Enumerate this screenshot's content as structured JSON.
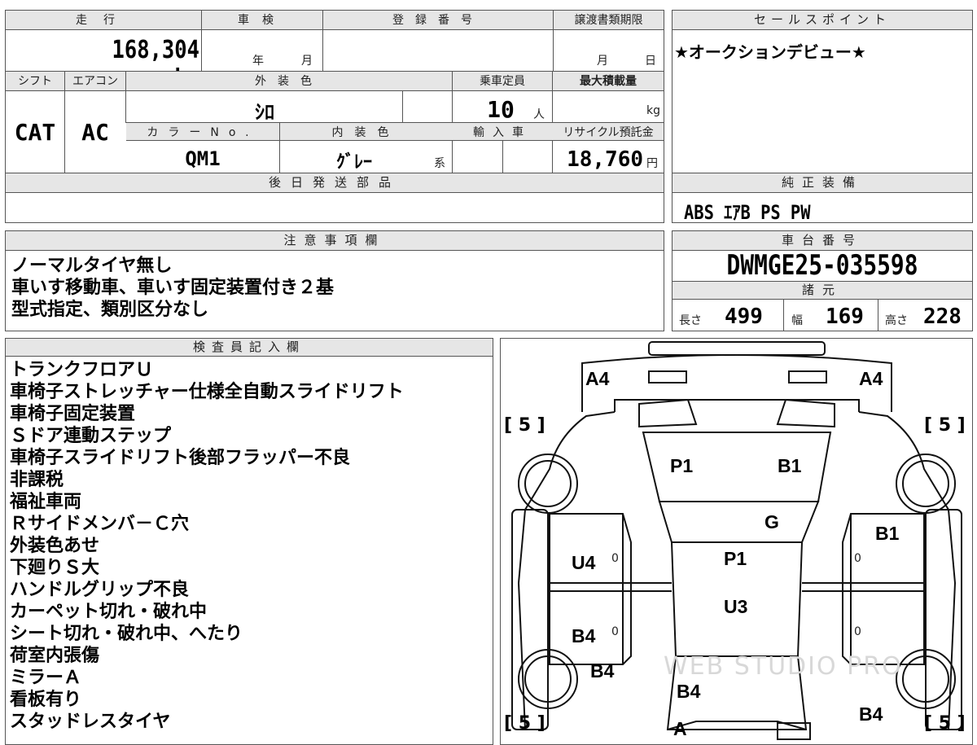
{
  "header": {
    "mileage_label": "走行",
    "shaken_label": "車検",
    "reg_label": "登録番号",
    "deadline_label": "譲渡書類期限",
    "sales_label": "セールスポイント",
    "mileage": "168,304 km",
    "shaken_year": "年",
    "shaken_month": "月",
    "deadline_month": "月",
    "deadline_day": "日"
  },
  "row2": {
    "shift_label": "シフト",
    "ac_label": "エアコン",
    "ext_color_label": "外装色",
    "capacity_label": "乗車定員",
    "max_load_label": "最大積載量",
    "shift": "CAT",
    "ac": "AC",
    "ext_color": "ｼﾛ",
    "capacity": "10",
    "capacity_unit": "人",
    "load_unit": "kg",
    "color_no_label": "カラーNo.",
    "int_color_label": "内装色",
    "import_label": "輸入車",
    "recycle_label": "リサイクル預託金",
    "color_no": "QM1",
    "int_color": "ｸﾞﾚｰ",
    "int_color_suffix": "系",
    "recycle": "18,760",
    "recycle_unit": "円"
  },
  "later_parts_label": "後日発送部品",
  "sales_point": "★オークションデビュー★",
  "equipment": {
    "label": "純正装備",
    "value": "ABS ｴｱB PS PW"
  },
  "notes": {
    "label": "注意事項欄",
    "lines": [
      "ノーマルタイヤ無し",
      "車いす移動車、車いす固定装置付き２基",
      "型式指定、類別区分なし"
    ]
  },
  "chassis": {
    "label": "車台番号",
    "value": "DWMGE25-035598"
  },
  "specs": {
    "label": "諸元",
    "length_label": "長さ",
    "length": "499",
    "width_label": "幅",
    "width": "169",
    "height_label": "高さ",
    "height": "228"
  },
  "inspector": {
    "label": "検査員記入欄",
    "lines": [
      "トランクフロアＵ",
      "車椅子ストレッチャー仕様全自動スライドリフト",
      "車椅子固定装置",
      "Ｓドア連動ステップ",
      "車椅子スライドリフト後部フラッパー不良",
      "非課税",
      "福祉車両",
      "Ｒサイドメンバ－Ｃ穴",
      "外装色あせ",
      "下廻りＳ大",
      "ハンドルグリップ不良",
      "カーペット切れ・破れ中",
      "シート切れ・破れ中、へたり",
      "荷室内張傷",
      "ミラーＡ",
      "看板有り",
      "スタッドレスタイヤ"
    ]
  },
  "diagram": {
    "marks": {
      "a4_left": "A4",
      "a4_right": "A4",
      "p1_front": "P1",
      "b1_hood": "B1",
      "g_windshield": "G",
      "b1_right_door": "B1",
      "u4_left_door": "U4",
      "p1_roof": "P1",
      "u3_roof": "U3",
      "b4_left_rear_door": "B4",
      "b4_left_quarter": "B4",
      "b4_rear": "B4",
      "b4_right_rear": "B4",
      "a_tail": "A"
    },
    "brackets": {
      "tl": "[ 5 ]",
      "tr": "[ 5 ]",
      "bl": "[ 5 ]",
      "br": "[ 5 ]"
    },
    "zeros": [
      "0",
      "0",
      "0",
      "0"
    ],
    "watermark": "WEB STUDIO PRO"
  }
}
